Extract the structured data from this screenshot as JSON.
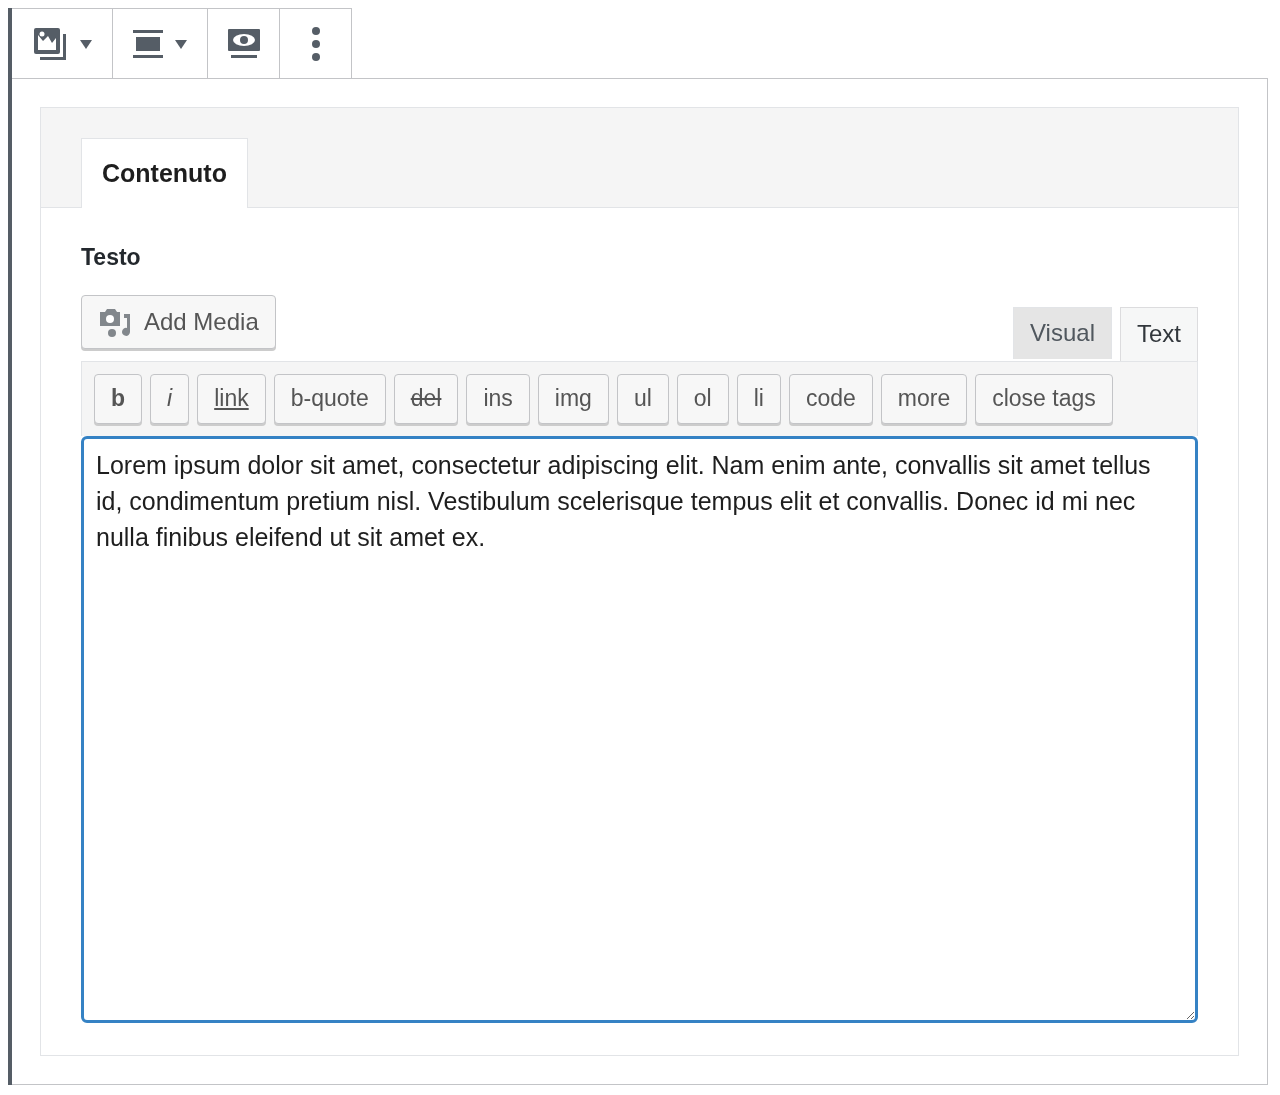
{
  "block_toolbar": [
    {
      "kind": "gallery",
      "dropdown": true
    },
    {
      "kind": "align",
      "dropdown": true
    },
    {
      "kind": "preview",
      "dropdown": false
    },
    {
      "kind": "more",
      "dropdown": false
    }
  ],
  "panel_tabs": [
    {
      "label": "Contenuto",
      "selected": true
    }
  ],
  "field_label": "Testo",
  "add_media": "Add Media",
  "editor_tabs": [
    {
      "label": "Visual",
      "selected": false
    },
    {
      "label": "Text",
      "selected": true
    }
  ],
  "quicktags": [
    {
      "label": "b",
      "kind": "bold"
    },
    {
      "label": "i",
      "kind": "italic"
    },
    {
      "label": "link",
      "kind": "underline"
    },
    {
      "label": "b-quote",
      "kind": "plain"
    },
    {
      "label": "del",
      "kind": "strike"
    },
    {
      "label": "ins",
      "kind": "plain"
    },
    {
      "label": "img",
      "kind": "plain"
    },
    {
      "label": "ul",
      "kind": "plain"
    },
    {
      "label": "ol",
      "kind": "plain"
    },
    {
      "label": "li",
      "kind": "plain"
    },
    {
      "label": "code",
      "kind": "plain"
    },
    {
      "label": "more",
      "kind": "plain"
    },
    {
      "label": "close tags",
      "kind": "plain"
    }
  ],
  "editor": {
    "value": "Lorem ipsum dolor sit amet, consectetur adipiscing elit. Nam enim ante, convallis sit amet tellus id, condimentum pretium nisl. Vestibulum scelerisque tempus elit et convallis. Donec id mi nec nulla finibus eleifend ut sit amet ex."
  }
}
